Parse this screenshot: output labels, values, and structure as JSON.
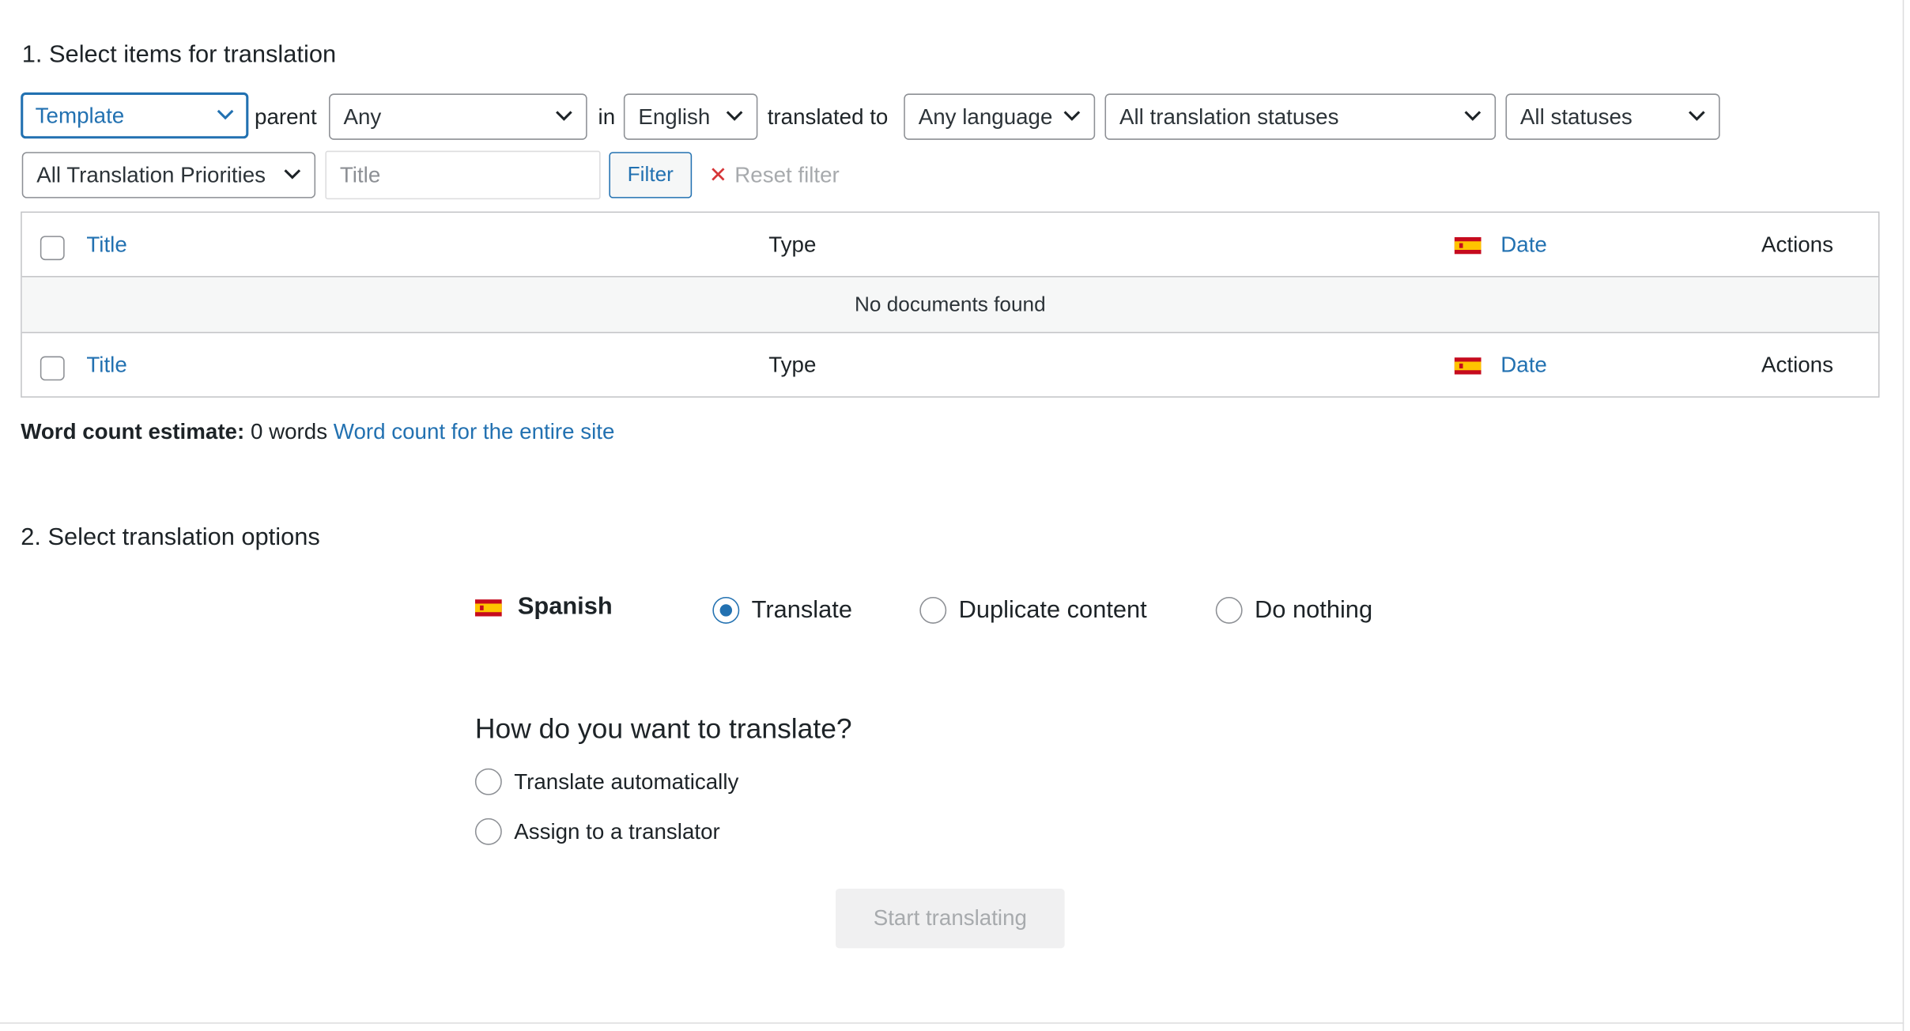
{
  "section1": {
    "heading": "1. Select items for translation"
  },
  "filters": {
    "type_select": "Template",
    "parent_label": "parent",
    "parent_select": "Any",
    "in_label": "in",
    "language_select": "English",
    "translated_to_label": "translated to",
    "target_language_select": "Any language",
    "translation_status_select": "All translation statuses",
    "status_select": "All statuses",
    "priority_select": "All Translation Priorities",
    "title_placeholder": "Title",
    "filter_button": "Filter",
    "reset_filter": "Reset filter"
  },
  "table": {
    "columns": {
      "title": "Title",
      "type": "Type",
      "date": "Date",
      "actions": "Actions"
    },
    "empty_message": "No documents found"
  },
  "word_count": {
    "label": "Word count estimate:",
    "value": "0 words",
    "link": "Word count for the entire site"
  },
  "section2": {
    "heading": "2. Select translation options",
    "language": "Spanish",
    "options": {
      "translate": "Translate",
      "duplicate": "Duplicate content",
      "nothing": "Do nothing"
    },
    "selected_option": "Translate",
    "how_heading": "How do you want to translate?",
    "methods": {
      "automatic": "Translate automatically",
      "translator": "Assign to a translator"
    },
    "start_button": "Start translating"
  },
  "colors": {
    "accent": "#2271b1",
    "border": "#8c8f94",
    "table_border": "#c3c4c7",
    "empty_row_bg": "#f6f7f7",
    "disabled_bg": "#f0f0f1",
    "disabled_text": "#a7aaad",
    "reset_x": "#d63638",
    "flag_red": "#c60b1e",
    "flag_yellow": "#ffc400"
  },
  "icons": [
    "chevron-down-icon",
    "close-icon",
    "spain-flag-icon"
  ]
}
